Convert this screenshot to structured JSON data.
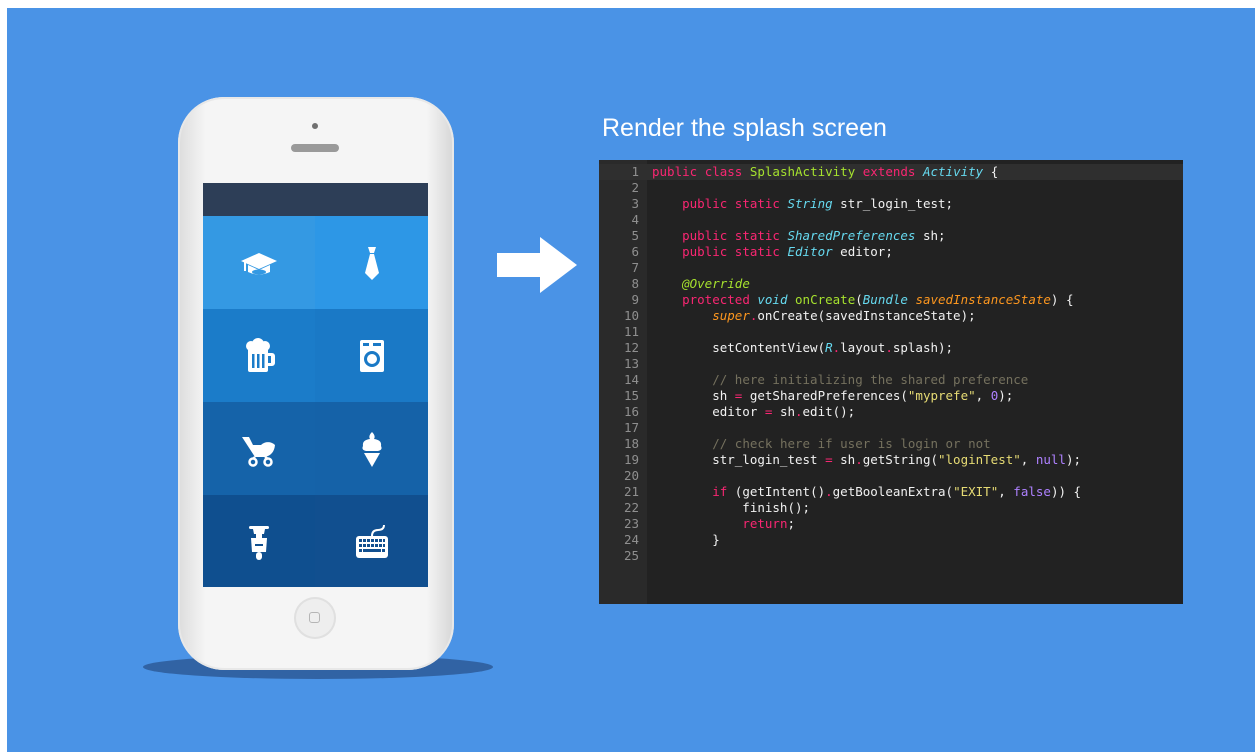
{
  "slide": {
    "background": "#4a93e6",
    "title": "Render the splash screen"
  },
  "phone": {
    "tiles": [
      {
        "icon": "graduation-cap-icon",
        "color": "#3499e3"
      },
      {
        "icon": "necktie-icon",
        "color": "#2d97e6"
      },
      {
        "icon": "beer-mug-icon",
        "color": "#1b7cc9"
      },
      {
        "icon": "washing-machine-icon",
        "color": "#1a79c6"
      },
      {
        "icon": "baby-stroller-icon",
        "color": "#1563a9"
      },
      {
        "icon": "ice-cream-cone-icon",
        "color": "#1562a8"
      },
      {
        "icon": "scooter-icon",
        "color": "#0f4f8f"
      },
      {
        "icon": "keyboard-icon",
        "color": "#114f8f"
      }
    ]
  },
  "code": {
    "lines": [
      {
        "n": "1",
        "active": true,
        "tokens": [
          [
            "kw",
            "public"
          ],
          [
            "t",
            " "
          ],
          [
            "kw",
            "class"
          ],
          [
            "t",
            " "
          ],
          [
            "id",
            "SplashActivity"
          ],
          [
            "t",
            " "
          ],
          [
            "kw",
            "extends"
          ],
          [
            "t",
            " "
          ],
          [
            "ty",
            "Activity"
          ],
          [
            "t",
            " {"
          ]
        ]
      },
      {
        "n": "2",
        "tokens": []
      },
      {
        "n": "3",
        "tokens": [
          [
            "t",
            "    "
          ],
          [
            "kw",
            "public"
          ],
          [
            "t",
            " "
          ],
          [
            "kw",
            "static"
          ],
          [
            "t",
            " "
          ],
          [
            "ty",
            "String"
          ],
          [
            "t",
            " str_login_test;"
          ]
        ]
      },
      {
        "n": "4",
        "tokens": []
      },
      {
        "n": "5",
        "tokens": [
          [
            "t",
            "    "
          ],
          [
            "kw",
            "public"
          ],
          [
            "t",
            " "
          ],
          [
            "kw",
            "static"
          ],
          [
            "t",
            " "
          ],
          [
            "ty",
            "SharedPreferences"
          ],
          [
            "t",
            " sh;"
          ]
        ]
      },
      {
        "n": "6",
        "tokens": [
          [
            "t",
            "    "
          ],
          [
            "kw",
            "public"
          ],
          [
            "t",
            " "
          ],
          [
            "kw",
            "static"
          ],
          [
            "t",
            " "
          ],
          [
            "ty",
            "Editor"
          ],
          [
            "t",
            " editor;"
          ]
        ]
      },
      {
        "n": "7",
        "tokens": []
      },
      {
        "n": "8",
        "tokens": [
          [
            "t",
            "    "
          ],
          [
            "ann",
            "@Override"
          ]
        ]
      },
      {
        "n": "9",
        "tokens": [
          [
            "t",
            "    "
          ],
          [
            "kw",
            "protected"
          ],
          [
            "t",
            " "
          ],
          [
            "ty",
            "void"
          ],
          [
            "t",
            " "
          ],
          [
            "id",
            "onCreate"
          ],
          [
            "t",
            "("
          ],
          [
            "ty",
            "Bundle"
          ],
          [
            "t",
            " "
          ],
          [
            "prm",
            "savedInstanceState"
          ],
          [
            "t",
            ") {"
          ]
        ]
      },
      {
        "n": "10",
        "tokens": [
          [
            "t",
            "        "
          ],
          [
            "prm",
            "super"
          ],
          [
            "op",
            "."
          ],
          [
            "t",
            "onCreate(savedInstanceState);"
          ]
        ]
      },
      {
        "n": "11",
        "tokens": []
      },
      {
        "n": "12",
        "tokens": [
          [
            "t",
            "        setContentView("
          ],
          [
            "ty",
            "R"
          ],
          [
            "op",
            "."
          ],
          [
            "t",
            "layout"
          ],
          [
            "op",
            "."
          ],
          [
            "t",
            "splash);"
          ]
        ]
      },
      {
        "n": "13",
        "tokens": []
      },
      {
        "n": "14",
        "tokens": [
          [
            "t",
            "        "
          ],
          [
            "com",
            "// here initializing the shared preference"
          ]
        ]
      },
      {
        "n": "15",
        "tokens": [
          [
            "t",
            "        sh "
          ],
          [
            "op",
            "="
          ],
          [
            "t",
            " getSharedPreferences("
          ],
          [
            "str",
            "\"myprefe\""
          ],
          [
            "t",
            ", "
          ],
          [
            "num",
            "0"
          ],
          [
            "t",
            ");"
          ]
        ]
      },
      {
        "n": "16",
        "tokens": [
          [
            "t",
            "        editor "
          ],
          [
            "op",
            "="
          ],
          [
            "t",
            " sh"
          ],
          [
            "op",
            "."
          ],
          [
            "t",
            "edit();"
          ]
        ]
      },
      {
        "n": "17",
        "tokens": []
      },
      {
        "n": "18",
        "tokens": [
          [
            "t",
            "        "
          ],
          [
            "com",
            "// check here if user is login or not"
          ]
        ]
      },
      {
        "n": "19",
        "tokens": [
          [
            "t",
            "        str_login_test "
          ],
          [
            "op",
            "="
          ],
          [
            "t",
            " sh"
          ],
          [
            "op",
            "."
          ],
          [
            "t",
            "getString("
          ],
          [
            "str",
            "\"loginTest\""
          ],
          [
            "t",
            ", "
          ],
          [
            "num",
            "null"
          ],
          [
            "t",
            ");"
          ]
        ]
      },
      {
        "n": "20",
        "tokens": []
      },
      {
        "n": "21",
        "tokens": [
          [
            "t",
            "        "
          ],
          [
            "kw",
            "if"
          ],
          [
            "t",
            " (getIntent()"
          ],
          [
            "op",
            "."
          ],
          [
            "t",
            "getBooleanExtra("
          ],
          [
            "str",
            "\"EXIT\""
          ],
          [
            "t",
            ", "
          ],
          [
            "num",
            "false"
          ],
          [
            "t",
            ")) {"
          ]
        ]
      },
      {
        "n": "22",
        "tokens": [
          [
            "t",
            "            finish();"
          ]
        ]
      },
      {
        "n": "23",
        "tokens": [
          [
            "t",
            "            "
          ],
          [
            "kw",
            "return"
          ],
          [
            "t",
            ";"
          ]
        ]
      },
      {
        "n": "24",
        "tokens": [
          [
            "t",
            "        }"
          ]
        ]
      },
      {
        "n": "25",
        "tokens": []
      }
    ]
  }
}
